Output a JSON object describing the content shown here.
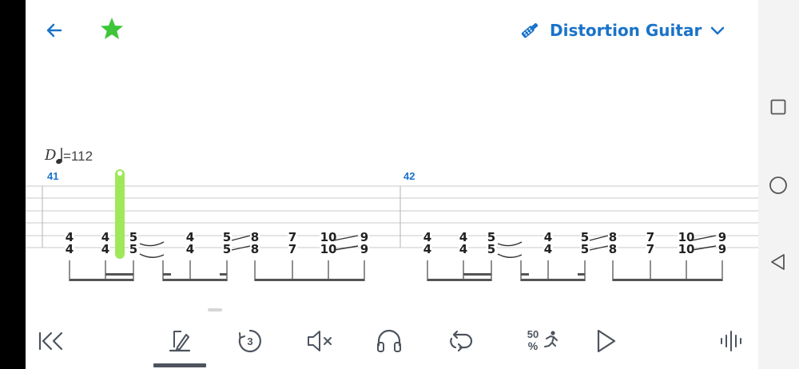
{
  "header": {
    "instrument_name": "Distortion Guitar",
    "icons": [
      "arrow-back-icon",
      "star-icon",
      "guitar-icon",
      "chevron-down-icon"
    ],
    "star_color": "#3ec53a",
    "accent_color": "#1a73c9"
  },
  "score": {
    "section": "D",
    "tempo": "=112",
    "measures": [
      "41",
      "42"
    ],
    "cursor_color": "#9fe85a",
    "beat_groups": [
      {
        "top": "4",
        "bottom": "4"
      },
      {
        "top": "4",
        "bottom": "4"
      },
      {
        "top": "5",
        "bottom": "5"
      },
      {
        "top": "4",
        "bottom": "4"
      },
      {
        "top": "5",
        "bottom": "5"
      },
      {
        "top": "8",
        "bottom": "8"
      },
      {
        "top": "7",
        "bottom": "7"
      },
      {
        "top": "10",
        "bottom": "10"
      },
      {
        "top": "9",
        "bottom": "9"
      }
    ]
  },
  "toolbar": {
    "items": [
      {
        "name": "rewind-to-start-icon"
      },
      {
        "name": "edit-icon",
        "active": true
      },
      {
        "name": "countdown-icon",
        "label": "3"
      },
      {
        "name": "mute-icon"
      },
      {
        "name": "headphones-icon"
      },
      {
        "name": "loop-icon"
      },
      {
        "name": "speed-icon",
        "label_top": "50",
        "label_bottom": "%"
      },
      {
        "name": "play-icon"
      },
      {
        "name": "audio-wave-icon"
      }
    ]
  },
  "system_nav": {
    "icons": [
      "recents-square-icon",
      "home-circle-icon",
      "back-triangle-icon"
    ]
  }
}
